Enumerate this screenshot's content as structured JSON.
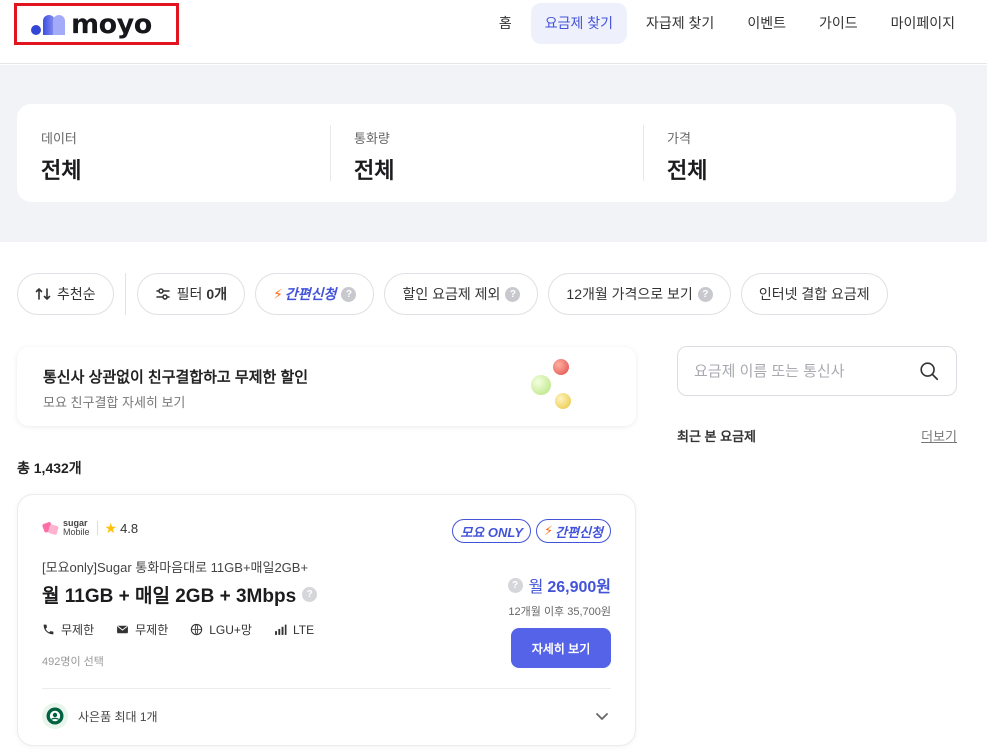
{
  "header": {
    "logo_text": "moyo",
    "nav": [
      "홈",
      "요금제 찾기",
      "자급제 찾기",
      "이벤트",
      "가이드",
      "마이페이지"
    ],
    "active_nav": "요금제 찾기"
  },
  "summary": [
    {
      "label": "데이터",
      "value": "전체"
    },
    {
      "label": "통화량",
      "value": "전체"
    },
    {
      "label": "가격",
      "value": "전체"
    }
  ],
  "chips": {
    "sort": "추천순",
    "filter": "필터",
    "filter_count": "0개",
    "easy_apply": "간편신청",
    "exclude_discount": "할인 요금제 제외",
    "twelve_month": "12개월 가격으로 보기",
    "internet_combo": "인터넷 결합 요금제"
  },
  "banner": {
    "title": "통신사 상관없이 친구결합하고 무제한 할인",
    "subtitle": "모요 친구결합 자세히 보기"
  },
  "total": "총 1,432개",
  "plan": {
    "brand_line1": "sugar",
    "brand_line2": "Mobile",
    "rating": "4.8",
    "badge_only": "모요 ONLY",
    "badge_easy": "간편신청",
    "name": "[모요only]Sugar 통화마음대로 11GB+매일2GB+",
    "title": "월 11GB + 매일 2GB + 3Mbps",
    "specs": {
      "call": "무제한",
      "sms": "무제한",
      "network": "LGU+망",
      "type": "LTE"
    },
    "selected": "492명이 선택",
    "price_prefix": "월",
    "price": "26,900원",
    "price_after": "12개월 이후 35,700원",
    "detail_button": "자세히 보기",
    "gift": "사은품 최대 1개"
  },
  "sidebar": {
    "search_placeholder": "요금제 이름 또는 통신사",
    "recent_title": "최근 본 요금제",
    "more": "더보기"
  },
  "colors": {
    "accent": "#4353d9",
    "button": "#5463e8",
    "highlight_border": "#e0151f",
    "band_bg": "#f2f3f6"
  }
}
